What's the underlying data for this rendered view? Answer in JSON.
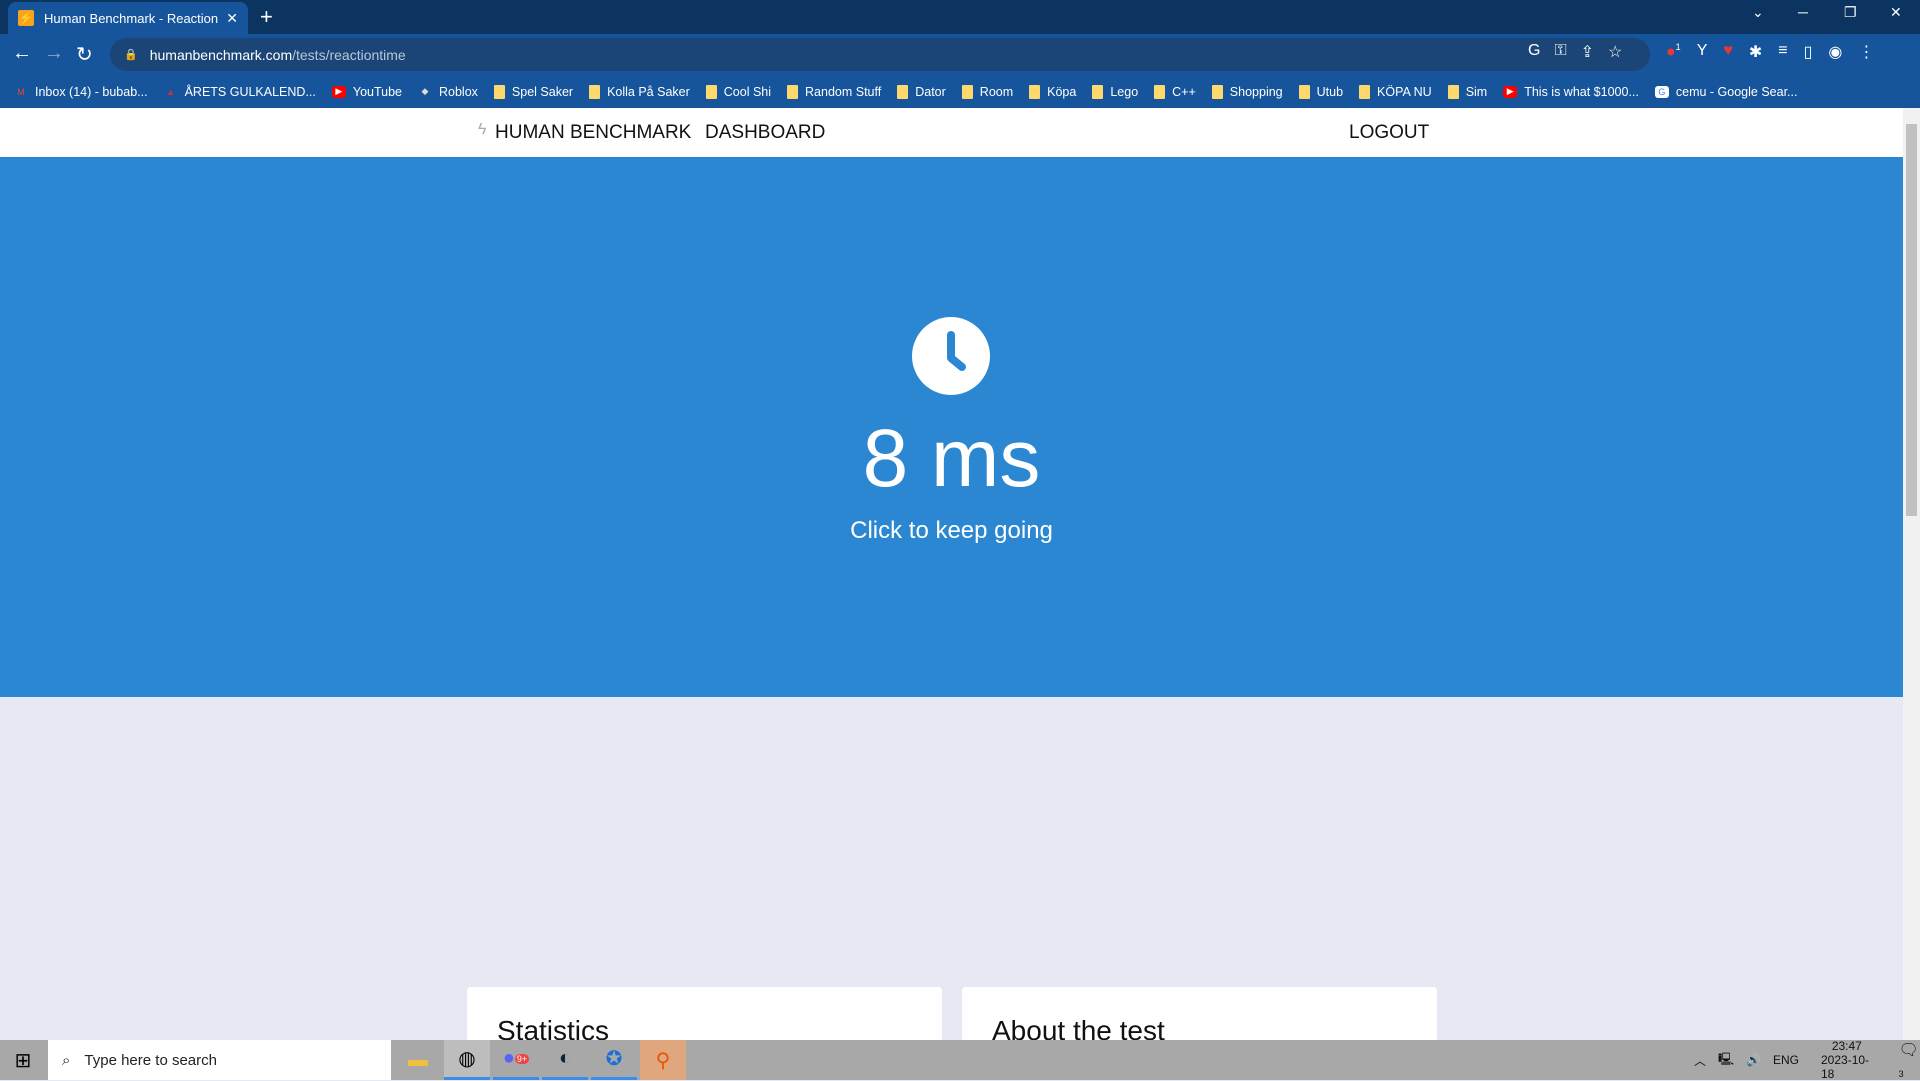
{
  "browser": {
    "tab_title": "Human Benchmark - Reaction Time",
    "url_domain": "humanbenchmark.com",
    "url_path": "/tests/reactiontime",
    "bookmarks": [
      {
        "label": "Inbox (14) - bubab...",
        "icon": "gmail-icon"
      },
      {
        "label": "ÅRETS GULKALEND...",
        "icon": "site-icon"
      },
      {
        "label": "YouTube",
        "icon": "youtube-icon"
      },
      {
        "label": "Roblox",
        "icon": "roblox-icon"
      },
      {
        "label": "Spel Saker",
        "icon": "folder-icon"
      },
      {
        "label": "Kolla På Saker",
        "icon": "folder-icon"
      },
      {
        "label": "Cool Shi",
        "icon": "folder-icon"
      },
      {
        "label": "Random Stuff",
        "icon": "folder-icon"
      },
      {
        "label": "Dator",
        "icon": "folder-icon"
      },
      {
        "label": "Room",
        "icon": "folder-icon"
      },
      {
        "label": "Köpa",
        "icon": "folder-icon"
      },
      {
        "label": "Lego",
        "icon": "folder-icon"
      },
      {
        "label": "C++",
        "icon": "folder-icon"
      },
      {
        "label": "Shopping",
        "icon": "folder-icon"
      },
      {
        "label": "Utub",
        "icon": "folder-icon"
      },
      {
        "label": "KÖPA NU",
        "icon": "folder-icon"
      },
      {
        "label": "Sim",
        "icon": "folder-icon"
      },
      {
        "label": "This is what $1000...",
        "icon": "youtube-icon"
      },
      {
        "label": "cemu - Google Sear...",
        "icon": "google-icon"
      }
    ],
    "extension_badge": "1"
  },
  "site": {
    "brand": "HUMAN BENCHMARK",
    "dashboard": "DASHBOARD",
    "logout": "LOGOUT",
    "result": "8 ms",
    "subtitle": "Click to keep going",
    "cards": [
      "Statistics",
      "About the test"
    ],
    "hero_color": "#2b87d1"
  },
  "taskbar": {
    "search_placeholder": "Type here to search",
    "language": "ENG",
    "time": "23:47",
    "date": "2023-10-18",
    "notifications": "3",
    "discord_badge": "9+"
  }
}
